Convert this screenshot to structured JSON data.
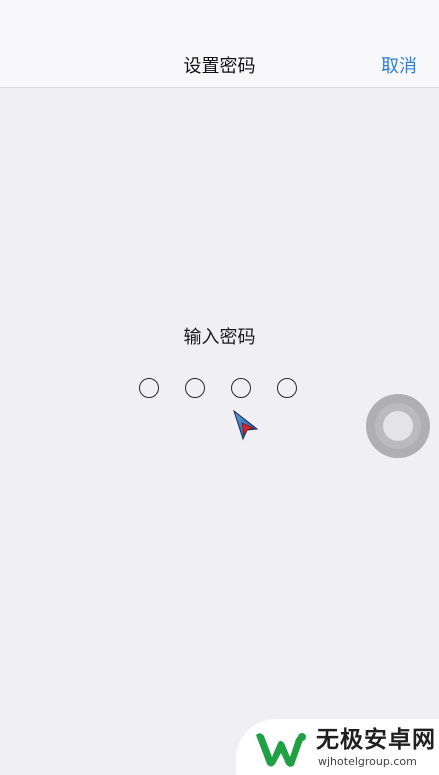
{
  "nav": {
    "title": "设置密码",
    "cancel_label": "取消"
  },
  "main": {
    "prompt": "输入密码",
    "pin_length": 4,
    "pin_entered": 0
  },
  "watermark": {
    "name": "无极安卓网",
    "url": "wjhotelgroup.com"
  },
  "colors": {
    "background": "#efeff4",
    "nav_background": "#f8f8fa",
    "accent": "#2f7fd0",
    "logo_green": "#1fa043"
  },
  "icons": {
    "cursor": "pointer-arrow-icon",
    "assistive_touch": "assistive-touch-icon",
    "logo": "wm-logo-icon"
  }
}
